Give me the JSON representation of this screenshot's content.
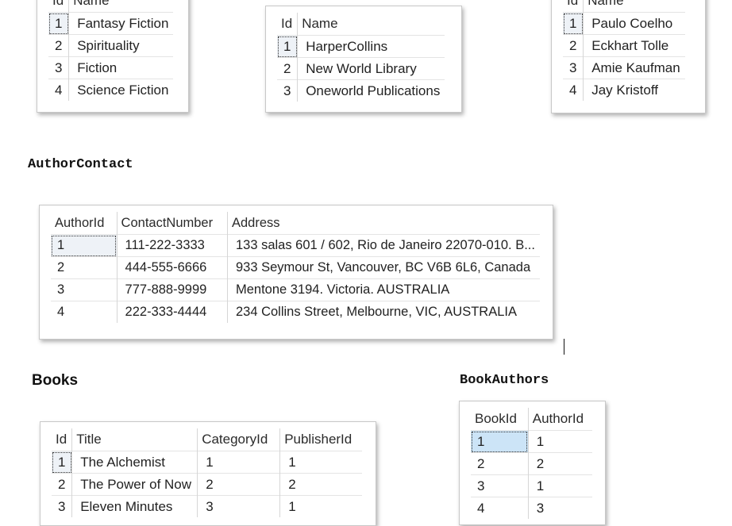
{
  "categories": {
    "columns": [
      "Id",
      "Name"
    ],
    "rows": [
      [
        "1",
        "Fantasy Fiction"
      ],
      [
        "2",
        "Spirituality"
      ],
      [
        "3",
        "Fiction"
      ],
      [
        "4",
        "Science Fiction"
      ]
    ]
  },
  "publishers": {
    "columns": [
      "Id",
      "Name"
    ],
    "rows": [
      [
        "1",
        "HarperCollins"
      ],
      [
        "2",
        "New World Library"
      ],
      [
        "3",
        "Oneworld Publications"
      ]
    ]
  },
  "authors": {
    "columns": [
      "Id",
      "Name"
    ],
    "rows": [
      [
        "1",
        "Paulo Coelho"
      ],
      [
        "2",
        "Eckhart Tolle"
      ],
      [
        "3",
        "Amie Kaufman"
      ],
      [
        "4",
        "Jay Kristoff"
      ]
    ]
  },
  "author_contact": {
    "label": "AuthorContact",
    "columns": [
      "AuthorId",
      "ContactNumber",
      "Address"
    ],
    "rows": [
      [
        "1",
        "111-222-3333",
        "133 salas 601 / 602, Rio de Janeiro 22070-010. B..."
      ],
      [
        "2",
        "444-555-6666",
        "933 Seymour St, Vancouver, BC V6B 6L6, Canada"
      ],
      [
        "3",
        "777-888-9999",
        "Mentone 3194. Victoria. AUSTRALIA"
      ],
      [
        "4",
        "222-333-4444",
        "234 Collins Street, Melbourne, VIC, AUSTRALIA"
      ]
    ]
  },
  "books": {
    "label": "Books",
    "columns": [
      "Id",
      "Title",
      "CategoryId",
      "PublisherId"
    ],
    "rows": [
      [
        "1",
        "The Alchemist",
        "1",
        "1"
      ],
      [
        "2",
        "The Power of Now",
        "2",
        "2"
      ],
      [
        "3",
        "Eleven Minutes",
        "3",
        "1"
      ]
    ]
  },
  "book_authors": {
    "label": "BookAuthors",
    "columns": [
      "BookId",
      "AuthorId"
    ],
    "rows": [
      [
        "1",
        "1"
      ],
      [
        "2",
        "2"
      ],
      [
        "3",
        "1"
      ],
      [
        "4",
        "3"
      ]
    ]
  }
}
